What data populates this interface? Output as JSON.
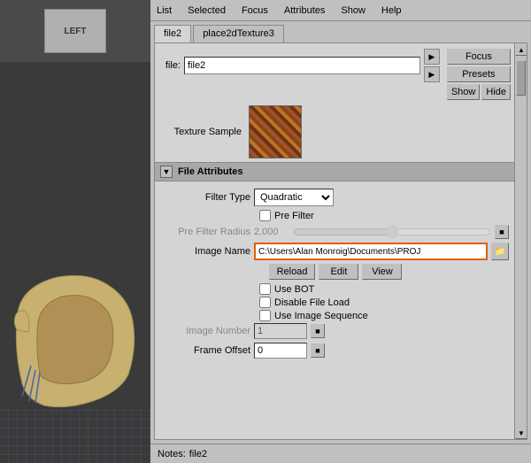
{
  "menu": {
    "items": [
      "List",
      "Selected",
      "Focus",
      "Attributes",
      "Show",
      "Help"
    ]
  },
  "tabs": [
    {
      "label": "file2",
      "active": true
    },
    {
      "label": "place2dTexture3",
      "active": false
    }
  ],
  "file_section": {
    "file_label": "file:",
    "file_value": "file2"
  },
  "buttons": {
    "focus": "Focus",
    "presets": "Presets",
    "show": "Show",
    "hide": "Hide"
  },
  "texture": {
    "label": "Texture Sample"
  },
  "file_attributes": {
    "title": "File Attributes",
    "filter_type_label": "Filter Type",
    "filter_type_value": "Quadratic",
    "pre_filter_label": "Pre Filter",
    "pre_filter_radius_label": "Pre Filter Radius",
    "pre_filter_radius_value": "2.000",
    "image_name_label": "Image Name",
    "image_name_value": "C:\\Users\\Alan Monroig\\Documents\\PROJ",
    "reload_btn": "Reload",
    "edit_btn": "Edit",
    "view_btn": "View",
    "use_bot_label": "Use BOT",
    "disable_file_load_label": "Disable File Load",
    "use_image_sequence_label": "Use Image Sequence",
    "image_number_label": "Image Number",
    "image_number_value": "1",
    "frame_offset_label": "Frame Offset",
    "frame_offset_value": "0"
  },
  "notes": {
    "label": "Notes:",
    "value": "file2"
  },
  "viewport": {
    "cube_label": "LEFT"
  }
}
